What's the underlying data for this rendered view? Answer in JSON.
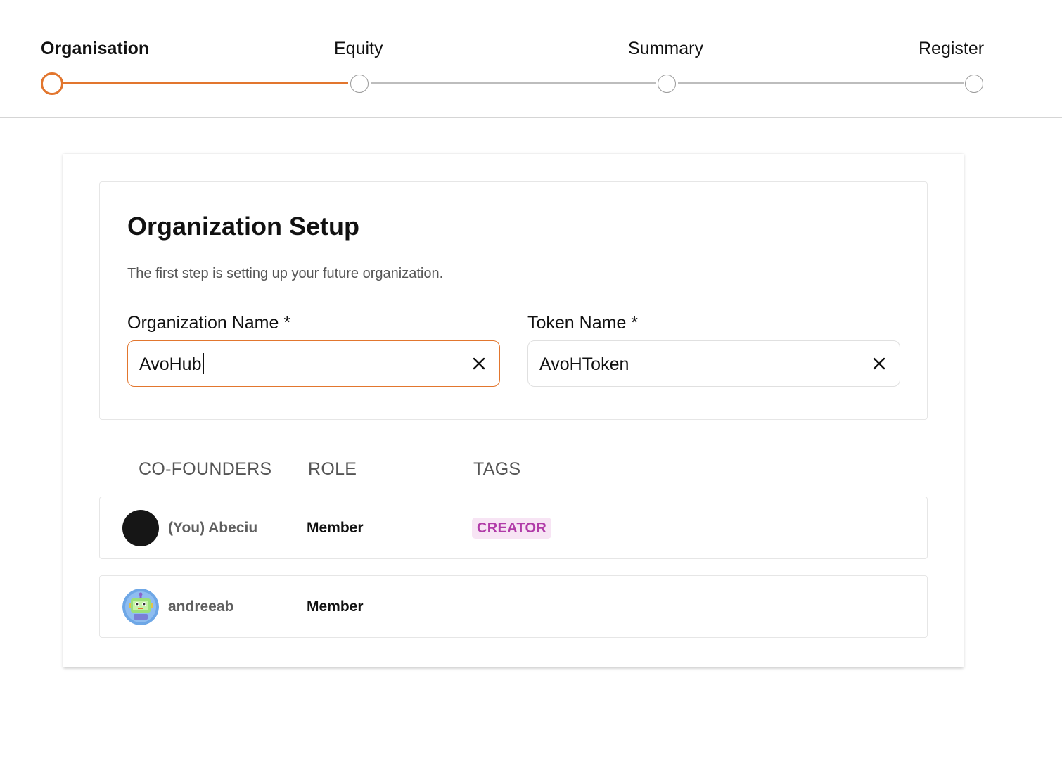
{
  "stepper": {
    "steps": [
      {
        "label": "Organisation",
        "state": "active"
      },
      {
        "label": "Equity",
        "state": "upcoming"
      },
      {
        "label": "Summary",
        "state": "upcoming"
      },
      {
        "label": "Register",
        "state": "upcoming"
      }
    ]
  },
  "setup": {
    "title": "Organization Setup",
    "subtitle": "The first step is setting up your future organization.",
    "org_name": {
      "label": "Organization Name *",
      "value": "AvoHub"
    },
    "token_name": {
      "label": "Token Name *",
      "value": "AvoHToken"
    }
  },
  "table": {
    "headers": [
      "CO-FOUNDERS",
      "ROLE",
      "TAGS"
    ],
    "rows": [
      {
        "name": "(You) Abeciu",
        "role": "Member",
        "tag": "CREATOR",
        "avatar": "dark-circle-avatar"
      },
      {
        "name": "andreeab",
        "role": "Member",
        "tag": "",
        "avatar": "robot-avatar"
      }
    ]
  },
  "colors": {
    "accent": "#e2762e",
    "tag_text": "#b13ba8",
    "tag_bg": "#f7e4f4"
  },
  "icons": {
    "clear": "close-icon"
  }
}
